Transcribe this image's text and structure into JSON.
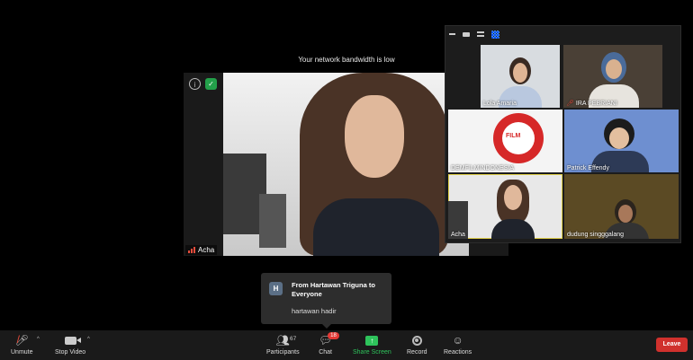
{
  "banner": {
    "text": "Your network bandwidth is low"
  },
  "main_view": {
    "speaker_name": "Acha"
  },
  "gallery": {
    "tiles": [
      {
        "name": "Lola Amaria",
        "muted": false
      },
      {
        "name": "IRA PEBRIANI",
        "muted": true
      },
      {
        "name": "DEMFILMINDONESIA",
        "muted": false
      },
      {
        "name": "Patrick Effendy",
        "muted": false
      },
      {
        "name": "Acha",
        "muted": false
      },
      {
        "name": "dudung singggalang",
        "muted": false
      }
    ],
    "logo_text": "FILM"
  },
  "chat_notification": {
    "avatar_letter": "H",
    "title": "From Hartawan Triguna to Everyone",
    "message": "hartawan hadir"
  },
  "toolbar": {
    "unmute": "Unmute",
    "stop_video": "Stop Video",
    "participants": "Participants",
    "participant_count": "67",
    "chat": "Chat",
    "chat_badge": "18",
    "share_screen": "Share Screen",
    "record": "Record",
    "reactions": "Reactions",
    "leave": "Leave"
  },
  "colors": {
    "accent_green": "#2ec35b",
    "leave_red": "#d0312d",
    "active_tile_border": "#e2d24a",
    "badge_red": "#e53935"
  }
}
